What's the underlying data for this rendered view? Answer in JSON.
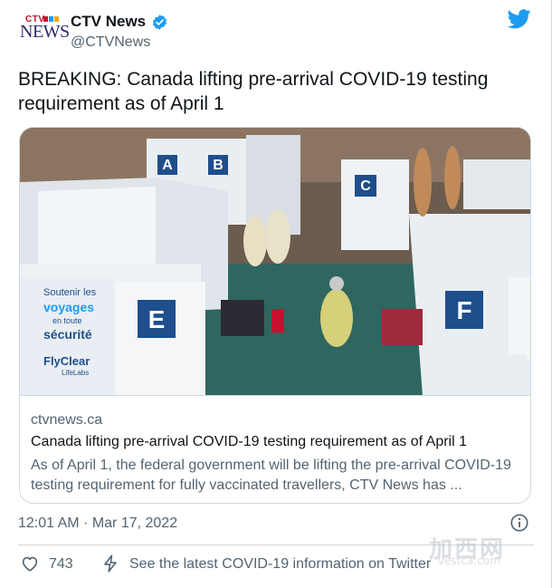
{
  "author": {
    "display_name": "CTV News",
    "handle": "@CTVNews",
    "logo_text_top": "CTV",
    "logo_text_bottom": "NEWS",
    "verified_icon": "verified-badge-icon"
  },
  "tweet": {
    "text": "BREAKING: Canada lifting pre-arrival COVID-19 testing requirement as of April 1",
    "timestamp": "12:01 AM · Mar 17, 2022",
    "likes": "743",
    "covid_link": "See the latest COVID-19 information on Twitter"
  },
  "card": {
    "domain": "ctvnews.ca",
    "title": "Canada lifting pre-arrival COVID-19 testing requirement as of April 1",
    "description": "As of April 1, the federal government will be lifting the pre-arrival COVID-19 testing requirement for fully vaccinated travellers, CTV News has ...",
    "image": {
      "booth_letters": [
        "A",
        "B",
        "C",
        "E",
        "F"
      ],
      "banner_lines": [
        "Soutenir les",
        "voyages",
        "en toute",
        "sécurité",
        "FlyClear",
        "LifeLabs"
      ]
    }
  },
  "watermark": {
    "chinese": "加西网",
    "url": "vestca.com"
  },
  "colors": {
    "twitter_blue": "#1d9bf0",
    "text_primary": "#0f1419",
    "text_secondary": "#536471",
    "border": "#cfd9de",
    "ctv_red": "#c8102e",
    "booth_blue": "#1f4e8c"
  },
  "icons": [
    "twitter-bird-icon",
    "verified-badge-icon",
    "info-icon",
    "heart-icon",
    "bolt-icon"
  ]
}
